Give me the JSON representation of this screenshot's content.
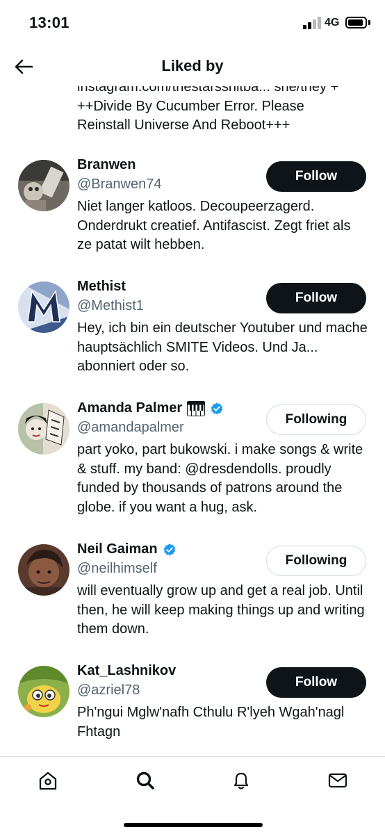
{
  "status_bar": {
    "time": "13:01",
    "network": "4G"
  },
  "header": {
    "title": "Liked by"
  },
  "top_bio_lines": [
    "instagram.com/thestarsshitba... she/they +",
    "++Divide By Cucumber Error. Please",
    "Reinstall Universe And Reboot+++"
  ],
  "users": [
    {
      "name": "Branwen",
      "handle": "@Branwen74",
      "button": "Follow",
      "following": false,
      "verified": false,
      "bio": "Niet langer katloos. Decoupeerzagerd. Onderdrukt creatief. Antifascist. Zegt friet als ze patat wilt hebben."
    },
    {
      "name": "Methist",
      "handle": "@Methist1",
      "button": "Follow",
      "following": false,
      "verified": false,
      "bio": "Hey, ich bin ein deutscher Youtuber und mache hauptsächlich SMITE Videos. Und Ja... abonniert oder so."
    },
    {
      "name": "Amanda Palmer",
      "handle": "@amandapalmer",
      "button": "Following",
      "following": true,
      "verified": true,
      "bio": "part yoko, part bukowski. i make songs & write & stuff. my band: @dresdendolls. proudly funded by thousands of patrons around the globe. if you want a hug, ask."
    },
    {
      "name": "Neil Gaiman",
      "handle": "@neilhimself",
      "button": "Following",
      "following": true,
      "verified": true,
      "bio": "will eventually grow up and get a real job. Until then, he will keep making things up and writing them down."
    },
    {
      "name": "Kat_Lashnikov",
      "handle": "@azriel78",
      "button": "Follow",
      "following": false,
      "verified": false,
      "bio": "Ph'ngui Mglw'nafh Cthulu R'lyeh Wgah'nagl Fhtagn"
    }
  ],
  "icons": {
    "back": "arrow-left-icon",
    "tabs": [
      "home-icon",
      "search-icon",
      "bell-icon",
      "mail-icon"
    ],
    "verified": "verified-badge-icon",
    "piano": "piano-emoji-icon"
  },
  "colors": {
    "primary_text": "#0f1419",
    "secondary_text": "#536471",
    "verified_blue": "#1d9bf0",
    "button_dark": "#0f1419"
  }
}
